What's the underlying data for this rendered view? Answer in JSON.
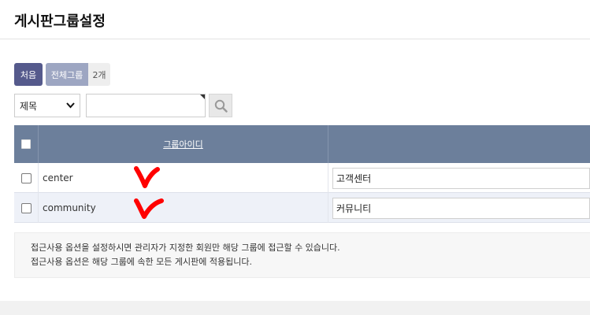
{
  "header": {
    "title": "게시판그룹설정"
  },
  "buttons": {
    "first": "처음",
    "all_groups": "전체그룹",
    "count": "2개"
  },
  "search": {
    "field_selected": "제목",
    "value": "",
    "chev_icon": "chevron-down-icon",
    "search_icon": "magnifier-icon"
  },
  "table": {
    "columns": {
      "group_id": "그룹아이디",
      "group_name": ""
    },
    "rows": [
      {
        "id": "center",
        "name": "고객센터"
      },
      {
        "id": "community",
        "name": "커뮤니티"
      }
    ]
  },
  "info": {
    "lines": [
      "접근사용 옵션을 설정하시면 관리자가 지정한 회원만 해당 그룹에 접근할 수 있습니다.",
      "접근사용 옵션은 해당 그룹에 속한 모든 게시판에 적용됩니다."
    ]
  },
  "colors": {
    "header_bar": "#6c7f9b",
    "btn_first": "#555a8c",
    "btn_all": "#9da6c2",
    "mark": "#ff0000"
  }
}
